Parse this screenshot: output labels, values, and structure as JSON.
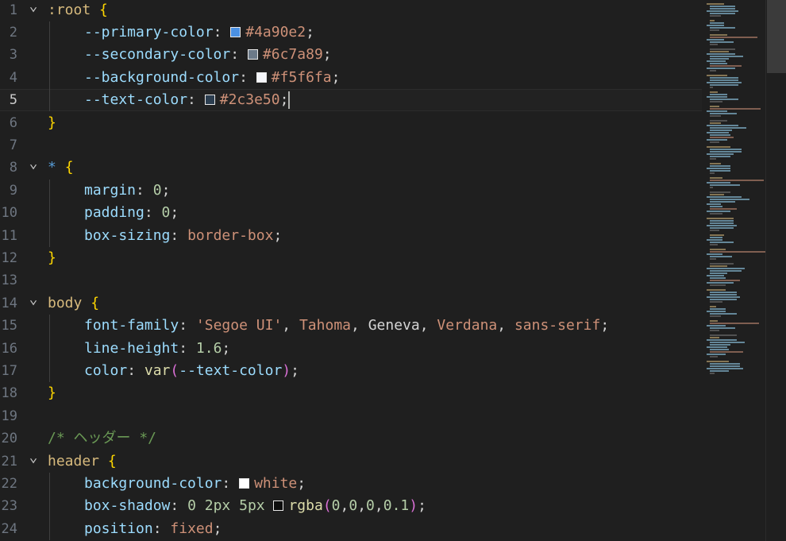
{
  "editor": {
    "current_line": 5,
    "lines": [
      {
        "n": "1",
        "fold": true,
        "tokens": [
          {
            "t": ":root",
            "c": "sel"
          },
          {
            "t": " ",
            "c": "plain"
          },
          {
            "t": "{",
            "c": "brace"
          }
        ]
      },
      {
        "n": "2",
        "indent": 1,
        "tokens": [
          {
            "t": "--primary-color",
            "c": "prop"
          },
          {
            "t": ": ",
            "c": "punct"
          },
          {
            "swatch": "#4a90e2"
          },
          {
            "t": "#4a90e2",
            "c": "str"
          },
          {
            "t": ";",
            "c": "punct"
          }
        ]
      },
      {
        "n": "3",
        "indent": 1,
        "tokens": [
          {
            "t": "--secondary-color",
            "c": "prop"
          },
          {
            "t": ": ",
            "c": "punct"
          },
          {
            "swatch": "#6c7a89"
          },
          {
            "t": "#6c7a89",
            "c": "str"
          },
          {
            "t": ";",
            "c": "punct"
          }
        ]
      },
      {
        "n": "4",
        "indent": 1,
        "tokens": [
          {
            "t": "--background-color",
            "c": "prop"
          },
          {
            "t": ": ",
            "c": "punct"
          },
          {
            "swatch": "#f5f6fa"
          },
          {
            "t": "#f5f6fa",
            "c": "str"
          },
          {
            "t": ";",
            "c": "punct"
          }
        ]
      },
      {
        "n": "5",
        "indent": 1,
        "tokens": [
          {
            "t": "--text-color",
            "c": "prop"
          },
          {
            "t": ": ",
            "c": "punct"
          },
          {
            "swatch": "#2c3e50"
          },
          {
            "t": "#2c3e50",
            "c": "str"
          },
          {
            "t": ";",
            "c": "punct"
          },
          {
            "cursor": true
          }
        ]
      },
      {
        "n": "6",
        "tokens": [
          {
            "t": "}",
            "c": "brace"
          }
        ]
      },
      {
        "n": "7",
        "tokens": []
      },
      {
        "n": "8",
        "fold": true,
        "tokens": [
          {
            "t": "*",
            "c": "selstar"
          },
          {
            "t": " ",
            "c": "plain"
          },
          {
            "t": "{",
            "c": "brace"
          }
        ]
      },
      {
        "n": "9",
        "indent": 1,
        "tokens": [
          {
            "t": "margin",
            "c": "prop"
          },
          {
            "t": ": ",
            "c": "punct"
          },
          {
            "t": "0",
            "c": "num"
          },
          {
            "t": ";",
            "c": "punct"
          }
        ]
      },
      {
        "n": "10",
        "indent": 1,
        "tokens": [
          {
            "t": "padding",
            "c": "prop"
          },
          {
            "t": ": ",
            "c": "punct"
          },
          {
            "t": "0",
            "c": "num"
          },
          {
            "t": ";",
            "c": "punct"
          }
        ]
      },
      {
        "n": "11",
        "indent": 1,
        "tokens": [
          {
            "t": "box-sizing",
            "c": "prop"
          },
          {
            "t": ": ",
            "c": "punct"
          },
          {
            "t": "border-box",
            "c": "kw"
          },
          {
            "t": ";",
            "c": "punct"
          }
        ]
      },
      {
        "n": "12",
        "tokens": [
          {
            "t": "}",
            "c": "brace"
          }
        ]
      },
      {
        "n": "13",
        "tokens": []
      },
      {
        "n": "14",
        "fold": true,
        "tokens": [
          {
            "t": "body",
            "c": "sel"
          },
          {
            "t": " ",
            "c": "plain"
          },
          {
            "t": "{",
            "c": "brace"
          }
        ]
      },
      {
        "n": "15",
        "indent": 1,
        "tokens": [
          {
            "t": "font-family",
            "c": "prop"
          },
          {
            "t": ": ",
            "c": "punct"
          },
          {
            "t": "'Segoe UI'",
            "c": "str"
          },
          {
            "t": ", ",
            "c": "punct"
          },
          {
            "t": "Tahoma",
            "c": "kw"
          },
          {
            "t": ", ",
            "c": "punct"
          },
          {
            "t": "Geneva",
            "c": "plain"
          },
          {
            "t": ", ",
            "c": "punct"
          },
          {
            "t": "Verdana",
            "c": "kw"
          },
          {
            "t": ", ",
            "c": "punct"
          },
          {
            "t": "sans-serif",
            "c": "kw"
          },
          {
            "t": ";",
            "c": "punct"
          }
        ]
      },
      {
        "n": "16",
        "indent": 1,
        "tokens": [
          {
            "t": "line-height",
            "c": "prop"
          },
          {
            "t": ": ",
            "c": "punct"
          },
          {
            "t": "1.6",
            "c": "num"
          },
          {
            "t": ";",
            "c": "punct"
          }
        ]
      },
      {
        "n": "17",
        "indent": 1,
        "tokens": [
          {
            "t": "color",
            "c": "prop"
          },
          {
            "t": ": ",
            "c": "punct"
          },
          {
            "t": "var",
            "c": "func"
          },
          {
            "t": "(",
            "c": "paren"
          },
          {
            "t": "--text-color",
            "c": "var"
          },
          {
            "t": ")",
            "c": "paren"
          },
          {
            "t": ";",
            "c": "punct"
          }
        ]
      },
      {
        "n": "18",
        "tokens": [
          {
            "t": "}",
            "c": "brace"
          }
        ]
      },
      {
        "n": "19",
        "tokens": []
      },
      {
        "n": "20",
        "tokens": [
          {
            "t": "/* ヘッダー */",
            "c": "comment"
          }
        ]
      },
      {
        "n": "21",
        "fold": true,
        "tokens": [
          {
            "t": "header",
            "c": "sel"
          },
          {
            "t": " ",
            "c": "plain"
          },
          {
            "t": "{",
            "c": "brace"
          }
        ]
      },
      {
        "n": "22",
        "indent": 1,
        "tokens": [
          {
            "t": "background-color",
            "c": "prop"
          },
          {
            "t": ": ",
            "c": "punct"
          },
          {
            "swatch": "#ffffff"
          },
          {
            "t": "white",
            "c": "kw"
          },
          {
            "t": ";",
            "c": "punct"
          }
        ]
      },
      {
        "n": "23",
        "indent": 1,
        "tokens": [
          {
            "t": "box-shadow",
            "c": "prop"
          },
          {
            "t": ": ",
            "c": "punct"
          },
          {
            "t": "0",
            "c": "num"
          },
          {
            "t": " ",
            "c": "plain"
          },
          {
            "t": "2px",
            "c": "num"
          },
          {
            "t": " ",
            "c": "plain"
          },
          {
            "t": "5px",
            "c": "num"
          },
          {
            "t": " ",
            "c": "plain"
          },
          {
            "swatch": "#0d0d0d"
          },
          {
            "t": "rgba",
            "c": "func"
          },
          {
            "t": "(",
            "c": "paren"
          },
          {
            "t": "0",
            "c": "num"
          },
          {
            "t": ",",
            "c": "punct"
          },
          {
            "t": "0",
            "c": "num"
          },
          {
            "t": ",",
            "c": "punct"
          },
          {
            "t": "0",
            "c": "num"
          },
          {
            "t": ",",
            "c": "punct"
          },
          {
            "t": "0.1",
            "c": "num"
          },
          {
            "t": ")",
            "c": "paren"
          },
          {
            "t": ";",
            "c": "punct"
          }
        ]
      },
      {
        "n": "24",
        "indent": 1,
        "tokens": [
          {
            "t": "position",
            "c": "prop"
          },
          {
            "t": ": ",
            "c": "punct"
          },
          {
            "t": "fixed",
            "c": "kw"
          },
          {
            "t": ";",
            "c": "punct"
          }
        ]
      }
    ]
  }
}
